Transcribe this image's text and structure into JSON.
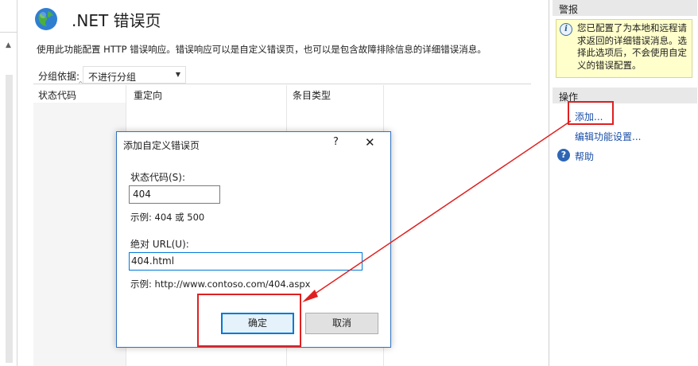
{
  "feature": {
    "title": ".NET 错误页",
    "description": "使用此功能配置 HTTP 错误响应。错误响应可以是自定义错误页，也可以是包含故障排除信息的详细错误消息。",
    "icon": "globe-icon"
  },
  "group_bar": {
    "label": "分组依据:",
    "selected": "不进行分组"
  },
  "columns": [
    "状态代码",
    "重定向",
    "条目类型"
  ],
  "alerts": {
    "header": "警报",
    "message": "您已配置了为本地和远程请求返回的详细错误消息。选择此选项后，不会使用自定义的错误配置。"
  },
  "actions": {
    "header": "操作",
    "add": "添加...",
    "edit": "编辑功能设置...",
    "help": "帮助"
  },
  "dialog": {
    "title": "添加自定义错误页",
    "help_symbol": "?",
    "close_symbol": "✕",
    "status_label": "状态代码(S):",
    "status_value": "404",
    "status_example": "示例: 404 或 500",
    "url_label": "绝对 URL(U):",
    "url_value": "404.html",
    "url_example": "示例: http://www.contoso.com/404.aspx",
    "ok": "确定",
    "cancel": "取消"
  },
  "colors": {
    "annotation_red": "#e02020",
    "link_blue": "#1b4fa8",
    "dialog_border": "#2f73c0",
    "alert_bg": "#ffffcc"
  }
}
